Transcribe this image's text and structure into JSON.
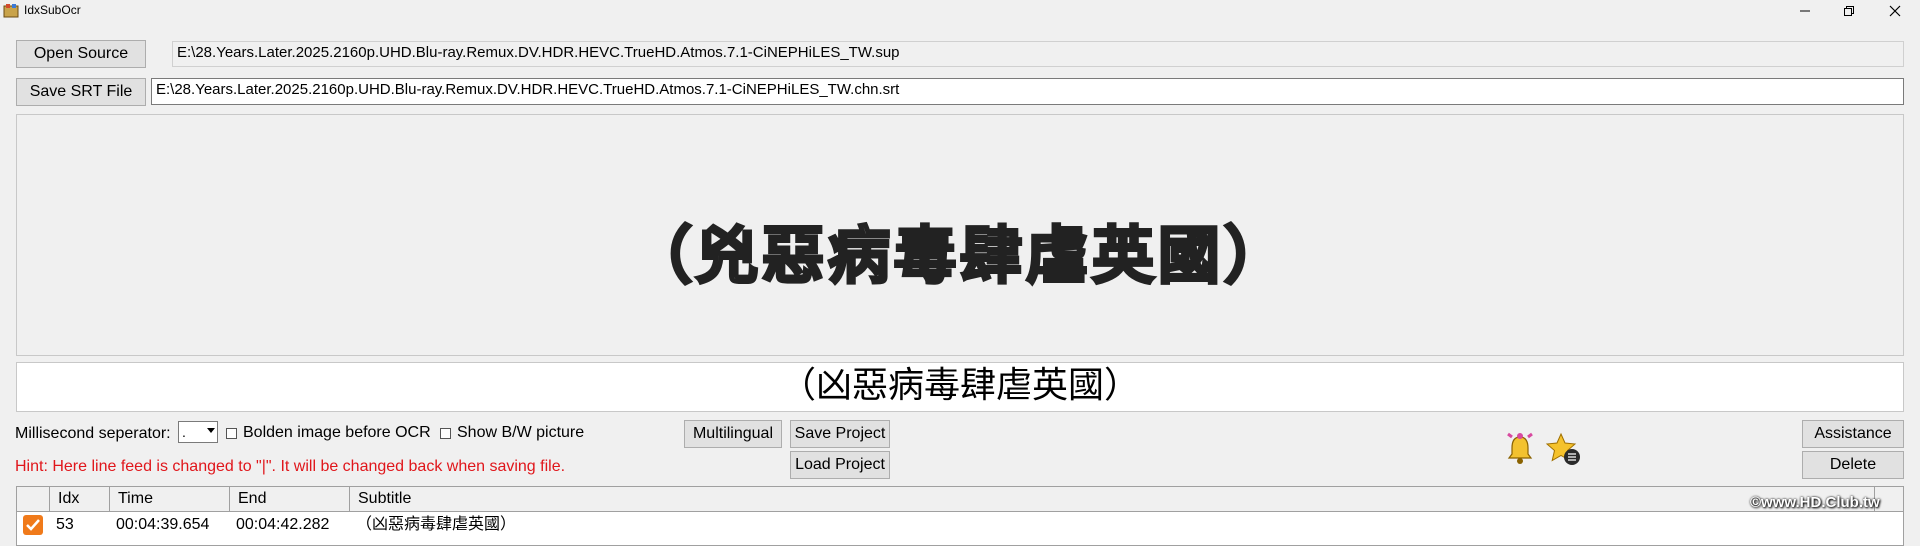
{
  "window": {
    "title": "IdxSubOcr"
  },
  "toolbar": {
    "open_source_label": "Open Source",
    "source_path": "E:\\28.Years.Later.2025.2160p.UHD.Blu-ray.Remux.DV.HDR.HEVC.TrueHD.Atmos.7.1-CiNEPHiLES_TW.sup",
    "save_srt_label": "Save SRT File",
    "srt_path": "E:\\28.Years.Later.2025.2160p.UHD.Blu-ray.Remux.DV.HDR.HEVC.TrueHD.Atmos.7.1-CiNEPHiLES_TW.chn.srt"
  },
  "preview": {
    "image_text": "（兇惡病毒肆虐英國）"
  },
  "ocr": {
    "text": "（凶惡病毒肆虐英國）"
  },
  "options": {
    "ms_separator_label": "Millisecond seperator:",
    "ms_separator_value": ".",
    "bolden_label": "Bolden image before OCR",
    "bolden_checked": false,
    "show_bw_label": "Show B/W picture",
    "show_bw_checked": false
  },
  "buttons": {
    "multilingual": "Multilingual",
    "save_project": "Save Project",
    "load_project": "Load Project",
    "assistance": "Assistance",
    "delete": "Delete"
  },
  "hint": "Hint: Here line feed is changed to \"|\". It will be changed back when saving file.",
  "icons": {
    "bell": "bell-icon",
    "star": "star-list-icon"
  },
  "grid": {
    "columns": [
      "Idx",
      "Time",
      "End",
      "Subtitle"
    ],
    "rows": [
      {
        "checked": true,
        "idx": "53",
        "time": "00:04:39.654",
        "end": "00:04:42.282",
        "subtitle": "（凶惡病毒肆虐英國）"
      }
    ]
  },
  "watermark": "©www.HD.Club.tw",
  "colors": {
    "hint": "#e0161b",
    "check_accent": "#f07a1a"
  }
}
